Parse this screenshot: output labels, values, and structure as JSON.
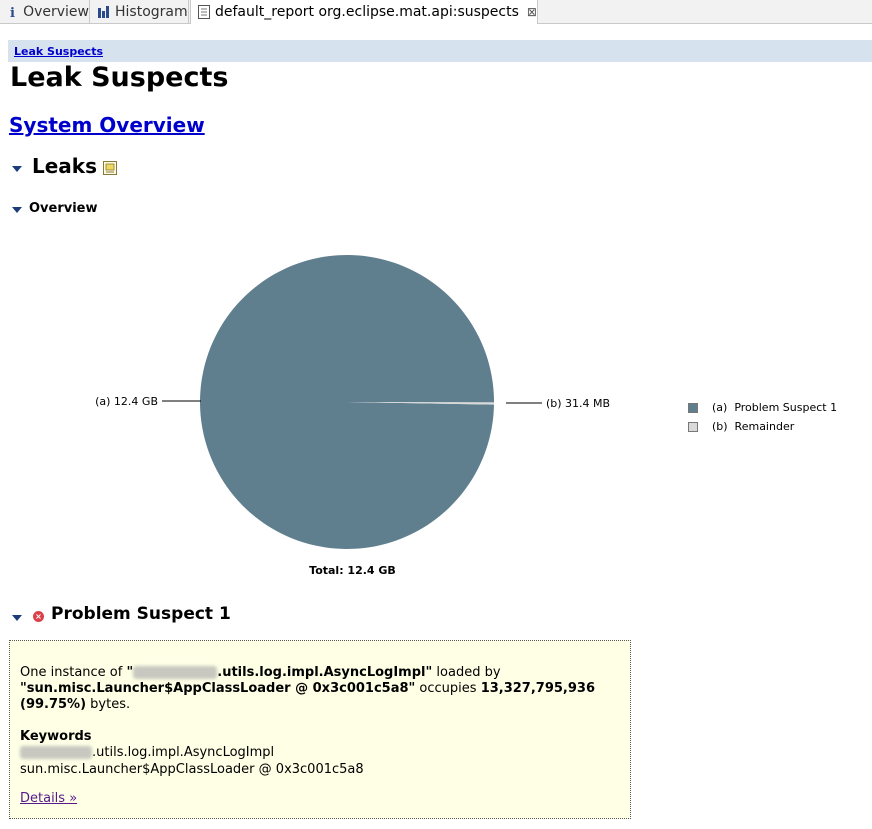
{
  "tabs": [
    {
      "label": "Overview",
      "icon": "info-icon"
    },
    {
      "label": "Histogram",
      "icon": "histogram-icon"
    },
    {
      "label": "default_report  org.eclipse.mat.api:suspects",
      "icon": "report-icon",
      "active": true,
      "close": "⊠"
    }
  ],
  "breadcrumb": "Leak Suspects",
  "page_title": "Leak Suspects",
  "system_overview_link": "System Overview",
  "leaks_heading": "Leaks",
  "overview_heading": "Overview",
  "chart_data": {
    "type": "pie",
    "slices": [
      {
        "label": "(a)  12.4 GB",
        "legend": "(a)  Problem Suspect 1",
        "value_bytes": 13327795936,
        "percent": 99.75,
        "color": "#5f7f8f"
      },
      {
        "label": "(b)  31.4 MB",
        "legend": "(b)  Remainder",
        "value_mb": 31.4,
        "percent": 0.25,
        "color": "#d9d9d9"
      }
    ],
    "total_label": "Total: 12.4 GB",
    "legend_position": "right"
  },
  "problem_suspect": {
    "title": "Problem Suspect 1",
    "line1_pre": "One instance of ",
    "line1_class": "\"",
    "line1_class_rest": ".utils.log.impl.AsyncLogImpl\"",
    "line1_mid": " loaded by",
    "loader": "\"sun.misc.Launcher$AppClassLoader @ 0x3c001c5a8\"",
    "occupies": " occupies ",
    "bytes": "13,327,795,936",
    "percent": "(99.75%)",
    "bytes_suffix": " bytes.",
    "keywords_heading": "Keywords",
    "keyword1_rest": ".utils.log.impl.AsyncLogImpl",
    "keyword2": "sun.misc.Launcher$AppClassLoader @ 0x3c001c5a8",
    "details_link": "Details »"
  }
}
